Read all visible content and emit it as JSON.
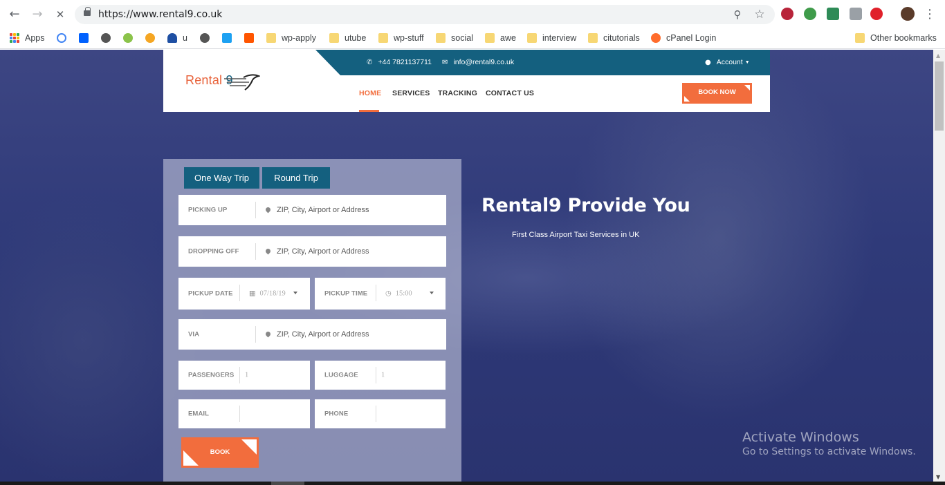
{
  "browser": {
    "url": "https://www.rental9.co.uk",
    "back_icon": "←",
    "forward_icon": "→",
    "stop_icon": "✕",
    "zoom_icon": "⚲",
    "star_icon": "☆",
    "menu_icon": "⋮"
  },
  "bookmarks": {
    "apps": "Apps",
    "u": "u",
    "wp_apply": "wp-apply",
    "utube": "utube",
    "wp_stuff": "wp-stuff",
    "social": "social",
    "awe": "awe",
    "interview": "interview",
    "citutorials": "citutorials",
    "cpanel": "cPanel Login",
    "other": "Other bookmarks"
  },
  "header": {
    "phone": "+44 7821137711",
    "email": "info@rental9.co.uk",
    "account": "Account",
    "logo_text": "Rental",
    "logo_number": "9",
    "menu": {
      "home": "HOME",
      "services": "SERVICES",
      "tracking": "TRACKING",
      "contact": "CONTACT US"
    },
    "book_now": "BOOK NOW"
  },
  "booking": {
    "tab_one_way": "One Way Trip",
    "tab_round": "Round Trip",
    "picking_up_label": "PICKING UP",
    "picking_up_placeholder": "ZIP, City, Airport or Address",
    "dropping_off_label": "DROPPING OFF",
    "dropping_off_placeholder": "ZIP, City, Airport or Address",
    "pickup_date_label": "PICKUP DATE",
    "pickup_date_value": "07/18/19",
    "pickup_time_label": "PICKUP TIME",
    "pickup_time_value": "15:00",
    "via_label": "VIA",
    "via_placeholder": "ZIP, City, Airport or Address",
    "passengers_label": "PASSENGERS",
    "passengers_value": "1",
    "luggage_label": "LUGGAGE",
    "luggage_value": "1",
    "email_label": "EMAIL",
    "phone_label": "PHONE",
    "book_button": "BOOK"
  },
  "hero": {
    "title": "Rental9 Provide You",
    "subtitle": "First Class Airport Taxi Services in UK"
  },
  "watermark": {
    "title": "Activate Windows",
    "subtitle": "Go to Settings to activate Windows."
  }
}
